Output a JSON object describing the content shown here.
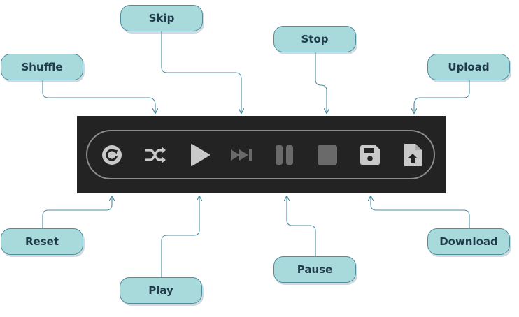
{
  "callouts": {
    "skip": "Skip",
    "stop": "Stop",
    "shuffle": "Shuffle",
    "upload": "Upload",
    "reset": "Reset",
    "download": "Download",
    "pause": "Pause",
    "play": "Play"
  },
  "toolbar": {
    "buttons": [
      {
        "name": "reset",
        "icon": "reset-icon",
        "enabled": true
      },
      {
        "name": "shuffle",
        "icon": "shuffle-icon",
        "enabled": true
      },
      {
        "name": "play",
        "icon": "play-icon",
        "enabled": true
      },
      {
        "name": "skip",
        "icon": "skip-icon",
        "enabled": false
      },
      {
        "name": "pause",
        "icon": "pause-icon",
        "enabled": false
      },
      {
        "name": "stop",
        "icon": "stop-icon",
        "enabled": false
      },
      {
        "name": "download",
        "icon": "save-icon",
        "enabled": true
      },
      {
        "name": "upload",
        "icon": "file-upload-icon",
        "enabled": true
      }
    ]
  },
  "colors": {
    "callout_fill": "#a8dadc",
    "callout_border": "#4e8da0",
    "toolbar_bg": "#232323",
    "icon_enabled": "#c9c9c9",
    "icon_disabled": "#6a6a6a",
    "connector": "#4e8da0"
  }
}
